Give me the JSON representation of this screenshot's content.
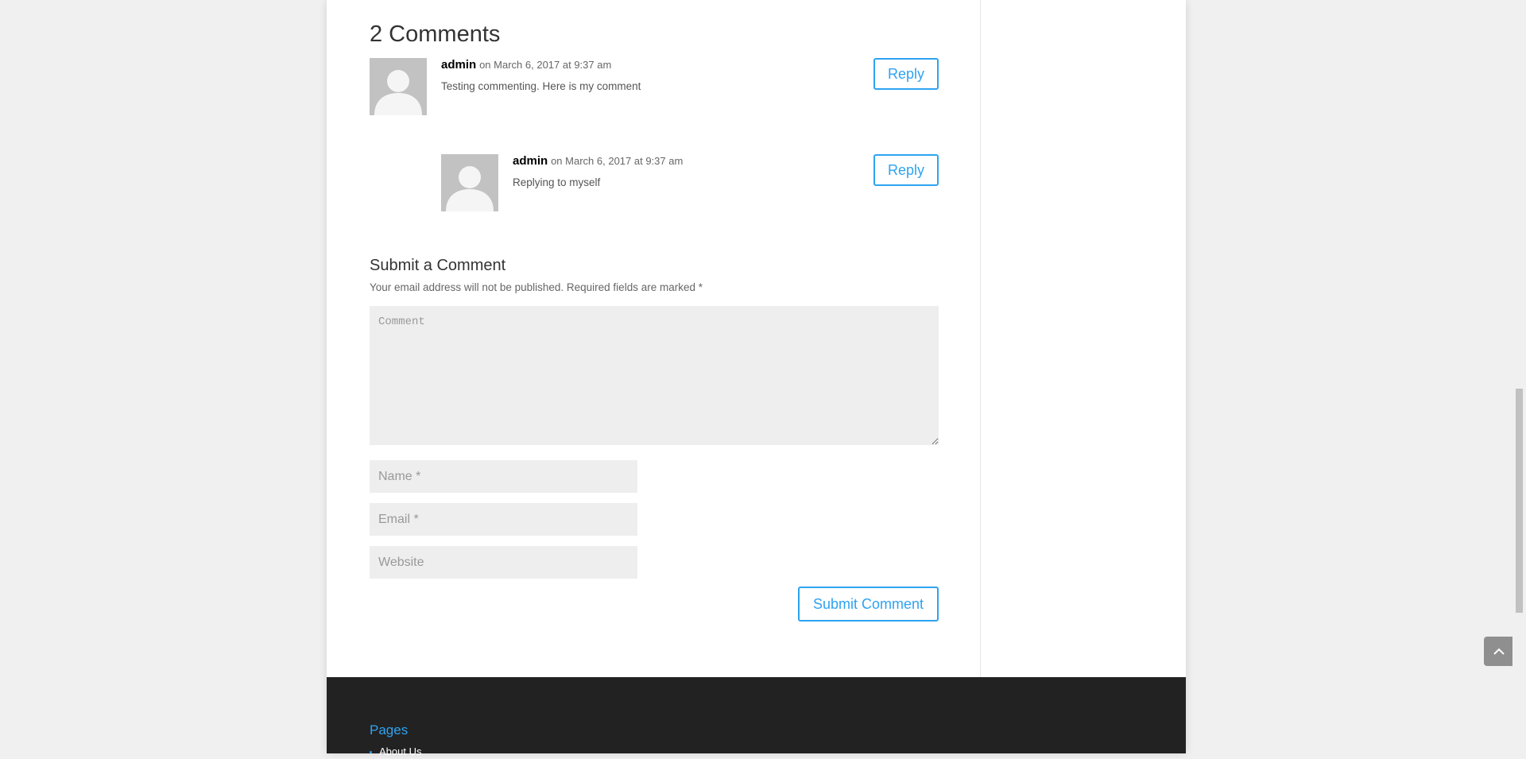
{
  "comments": {
    "title": "2 Comments",
    "items": [
      {
        "author": "admin",
        "date": "on March 6, 2017 at 9:37 am",
        "text": "Testing commenting. Here is my comment",
        "reply_label": "Reply",
        "avatar_icon": "default-user-avatar-icon"
      },
      {
        "author": "admin",
        "date": "on March 6, 2017 at 9:37 am",
        "text": "Replying to myself",
        "reply_label": "Reply",
        "avatar_icon": "default-user-avatar-icon"
      }
    ]
  },
  "comment_form": {
    "title": "Submit a Comment",
    "notes": "Your email address will not be published. Required fields are marked *",
    "comment_placeholder": "Comment",
    "name_placeholder": "Name *",
    "email_placeholder": "Email *",
    "website_placeholder": "Website",
    "submit_label": "Submit Comment"
  },
  "footer": {
    "widget_title": "Pages",
    "links": [
      "About Us"
    ]
  },
  "back_to_top": {
    "icon": "chevron-up-icon"
  },
  "colors": {
    "accent": "#2ea3f2",
    "footer_bg": "#222222",
    "field_bg": "#eeeeee",
    "avatar_bg": "#c2c2c2"
  }
}
